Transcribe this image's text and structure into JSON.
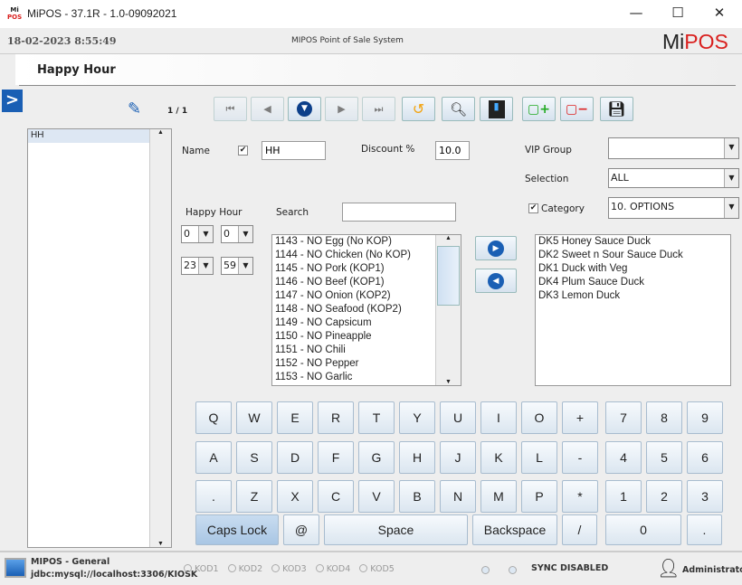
{
  "window": {
    "title": "MiPOS - 37.1R - 1.0-09092021",
    "logo_top": "Mi",
    "logo_bottom": "POS",
    "minimize": "—",
    "maximize": "☐",
    "close": "✕"
  },
  "header": {
    "datetime": "18-02-2023 8:55:49",
    "system": "MIPOS Point of Sale System",
    "brand_mi": "Mi",
    "brand_pos": "POS"
  },
  "page": {
    "title": "Happy Hour",
    "record": "1 / 1"
  },
  "left_list": {
    "items": [
      "HH"
    ]
  },
  "form": {
    "name_label": "Name",
    "name_value": "HH",
    "discount_label": "Discount %",
    "discount_value": "10.0",
    "vip_label": "VIP Group",
    "vip_value": "",
    "selection_label": "Selection",
    "selection_value": "ALL",
    "category_label": "Category",
    "category_value": "10. OPTIONS",
    "happy_hour_label": "Happy Hour",
    "search_label": "Search",
    "search_value": "",
    "start_hour": "0",
    "start_min": "0",
    "end_hour": "23",
    "end_min": "59"
  },
  "available_items": [
    "1143 - NO Egg (No KOP)",
    "1144 - NO Chicken (No KOP)",
    "1145 - NO Pork (KOP1)",
    "1146 - NO Beef (KOP1)",
    "1147 - NO Onion (KOP2)",
    "1148 - NO Seafood (KOP2)",
    "1149 - NO Capsicum",
    "1150 - NO Pineapple",
    "1151 - NO Chili",
    "1152 - NO Pepper",
    "1153 - NO Garlic"
  ],
  "selected_items": [
    "DK5  Honey Sauce Duck",
    "DK2  Sweet n Sour Sauce Duck",
    "DK1  Duck with Veg",
    "DK4  Plum Sauce Duck",
    "DK3  Lemon Duck"
  ],
  "keyboard": {
    "row1": [
      "Q",
      "W",
      "E",
      "R",
      "T",
      "Y",
      "U",
      "I",
      "O",
      "+"
    ],
    "row2": [
      "A",
      "S",
      "D",
      "F",
      "G",
      "H",
      "J",
      "K",
      "L",
      "-"
    ],
    "row3": [
      ".",
      "Z",
      "X",
      "C",
      "V",
      "B",
      "N",
      "M",
      "P",
      "*"
    ],
    "num1": [
      "7",
      "8",
      "9"
    ],
    "num2": [
      "4",
      "5",
      "6"
    ],
    "num3": [
      "1",
      "2",
      "3"
    ],
    "caps": "Caps Lock",
    "at": "@",
    "space": "Space",
    "backspace": "Backspace",
    "slash": "/",
    "zero": "0",
    "dot": "."
  },
  "status": {
    "profile": "MIPOS - General",
    "db": "jdbc:mysql://localhost:3306/KIOSK",
    "kods": [
      "KOD1",
      "KOD2",
      "KOD3",
      "KOD4",
      "KOD5"
    ],
    "sync": "SYNC DISABLED",
    "user": "Administrator"
  },
  "colors": {
    "brand_red": "#d9201e",
    "accent_blue": "#1a5fb4"
  }
}
